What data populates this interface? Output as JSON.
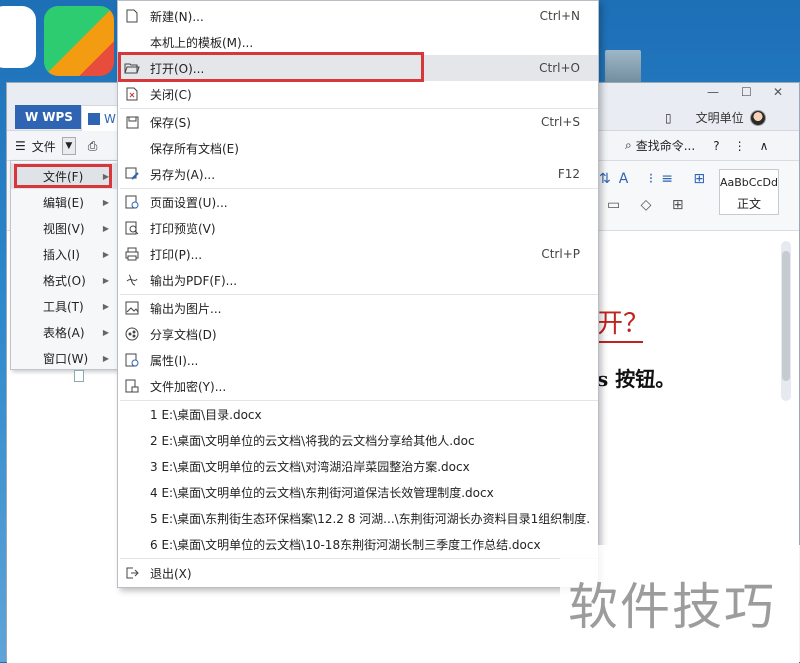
{
  "titlebar": {
    "wps_tab_label": "WPS",
    "doc_tab_label": "W",
    "cloud_docs_label": "文明单位"
  },
  "toolbar": {
    "file_label": "文件",
    "search_label": "查找命令..."
  },
  "ribbon": {
    "style_sample": "AaBbCcDd",
    "style_name": "正文"
  },
  "document": {
    "heading": "开？",
    "body_line": "s 按钮。"
  },
  "side_menu": {
    "items": [
      {
        "label": "文件(F)",
        "active": true
      },
      {
        "label": "编辑(E)"
      },
      {
        "label": "视图(V)"
      },
      {
        "label": "插入(I)"
      },
      {
        "label": "格式(O)"
      },
      {
        "label": "工具(T)"
      },
      {
        "label": "表格(A)"
      },
      {
        "label": "窗口(W)"
      }
    ]
  },
  "file_menu": {
    "items": [
      {
        "label": "新建(N)...",
        "shortcut": "Ctrl+N",
        "icon": "new-doc-icon"
      },
      {
        "label": "本机上的模板(M)...",
        "shortcut": "",
        "icon": ""
      },
      {
        "label": "打开(O)...",
        "shortcut": "Ctrl+O",
        "icon": "folder-open-icon"
      },
      {
        "label": "关闭(C)",
        "shortcut": "",
        "icon": "close-doc-icon"
      },
      {
        "label": "保存(S)",
        "shortcut": "Ctrl+S",
        "icon": "save-icon"
      },
      {
        "label": "保存所有文档(E)",
        "shortcut": "",
        "icon": ""
      },
      {
        "label": "另存为(A)...",
        "shortcut": "F12",
        "icon": "save-as-icon"
      },
      {
        "label": "页面设置(U)...",
        "shortcut": "",
        "icon": "page-setup-icon"
      },
      {
        "label": "打印预览(V)",
        "shortcut": "",
        "icon": "print-preview-icon"
      },
      {
        "label": "打印(P)...",
        "shortcut": "Ctrl+P",
        "icon": "print-icon"
      },
      {
        "label": "输出为PDF(F)...",
        "shortcut": "",
        "icon": "pdf-export-icon"
      },
      {
        "label": "输出为图片...",
        "shortcut": "",
        "icon": "image-export-icon"
      },
      {
        "label": "分享文档(D)",
        "shortcut": "",
        "icon": "share-icon"
      },
      {
        "label": "属性(I)...",
        "shortcut": "",
        "icon": "properties-icon"
      },
      {
        "label": "文件加密(Y)...",
        "shortcut": "",
        "icon": "encrypt-icon"
      }
    ],
    "recent": [
      "1 E:\\桌面\\目录.docx",
      "2 E:\\桌面\\文明单位的云文档\\将我的云文档分享给其他人.doc",
      "3 E:\\桌面\\文明单位的云文档\\对湾湖沿岸菜园整治方案.docx",
      "4 E:\\桌面\\文明单位的云文档\\东荆街河道保洁长效管理制度.docx",
      "5 E:\\桌面\\东荆街生态环保档案\\12.2 8 河湖...\\东荆街河湖长办资料目录1组织制度.d...",
      "6 E:\\桌面\\文明单位的云文档\\10-18东荆街河湖长制三季度工作总结.docx"
    ],
    "exit_label": "退出(X)"
  },
  "watermark": {
    "text": "软件技巧"
  },
  "colors": {
    "highlight": "#d7373b",
    "wps_blue": "#2f64b2",
    "doc_red": "#c0241e"
  }
}
